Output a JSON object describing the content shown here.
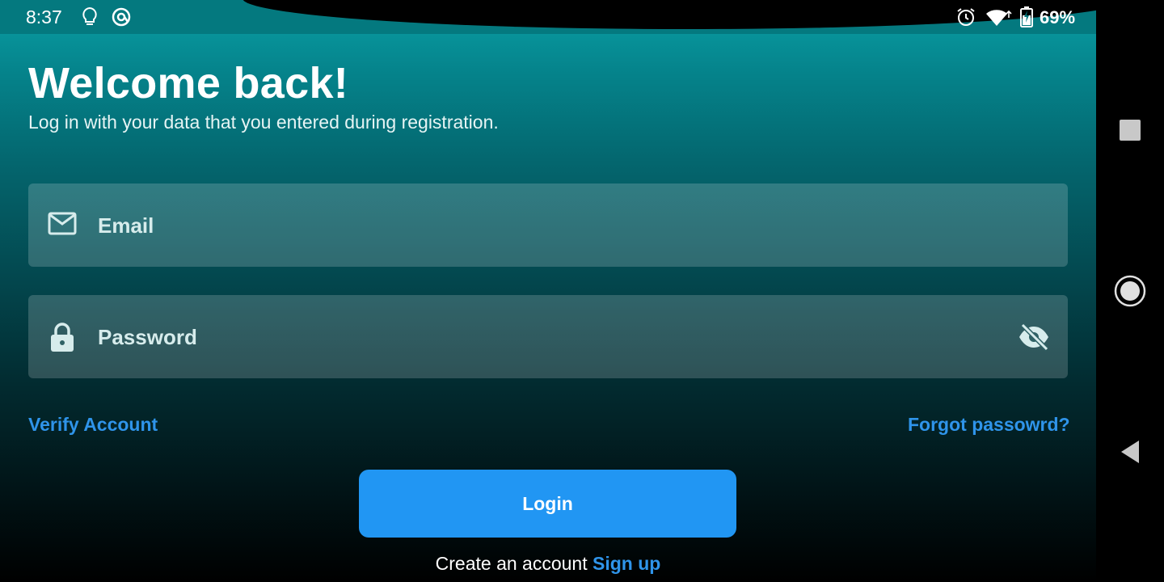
{
  "status_bar": {
    "time": "8:37",
    "battery": "69%",
    "icons": [
      "lightbulb-icon",
      "at-sign-icon",
      "alarm-icon",
      "wifi-icon",
      "battery-charging-icon"
    ]
  },
  "header": {
    "title": "Welcome back!",
    "subtitle": "Log in with your data that you entered during registration."
  },
  "form": {
    "email_placeholder": "Email",
    "password_placeholder": "Password"
  },
  "links": {
    "verify_account": "Verify Account",
    "forgot_password": "Forgot passowrd?"
  },
  "login_button": "Login",
  "signup": {
    "prompt": "Create an account",
    "link": "Sign up"
  },
  "colors": {
    "accent": "#2196f3",
    "link": "#2f94ea",
    "teal_top": "#0aa0a6"
  }
}
